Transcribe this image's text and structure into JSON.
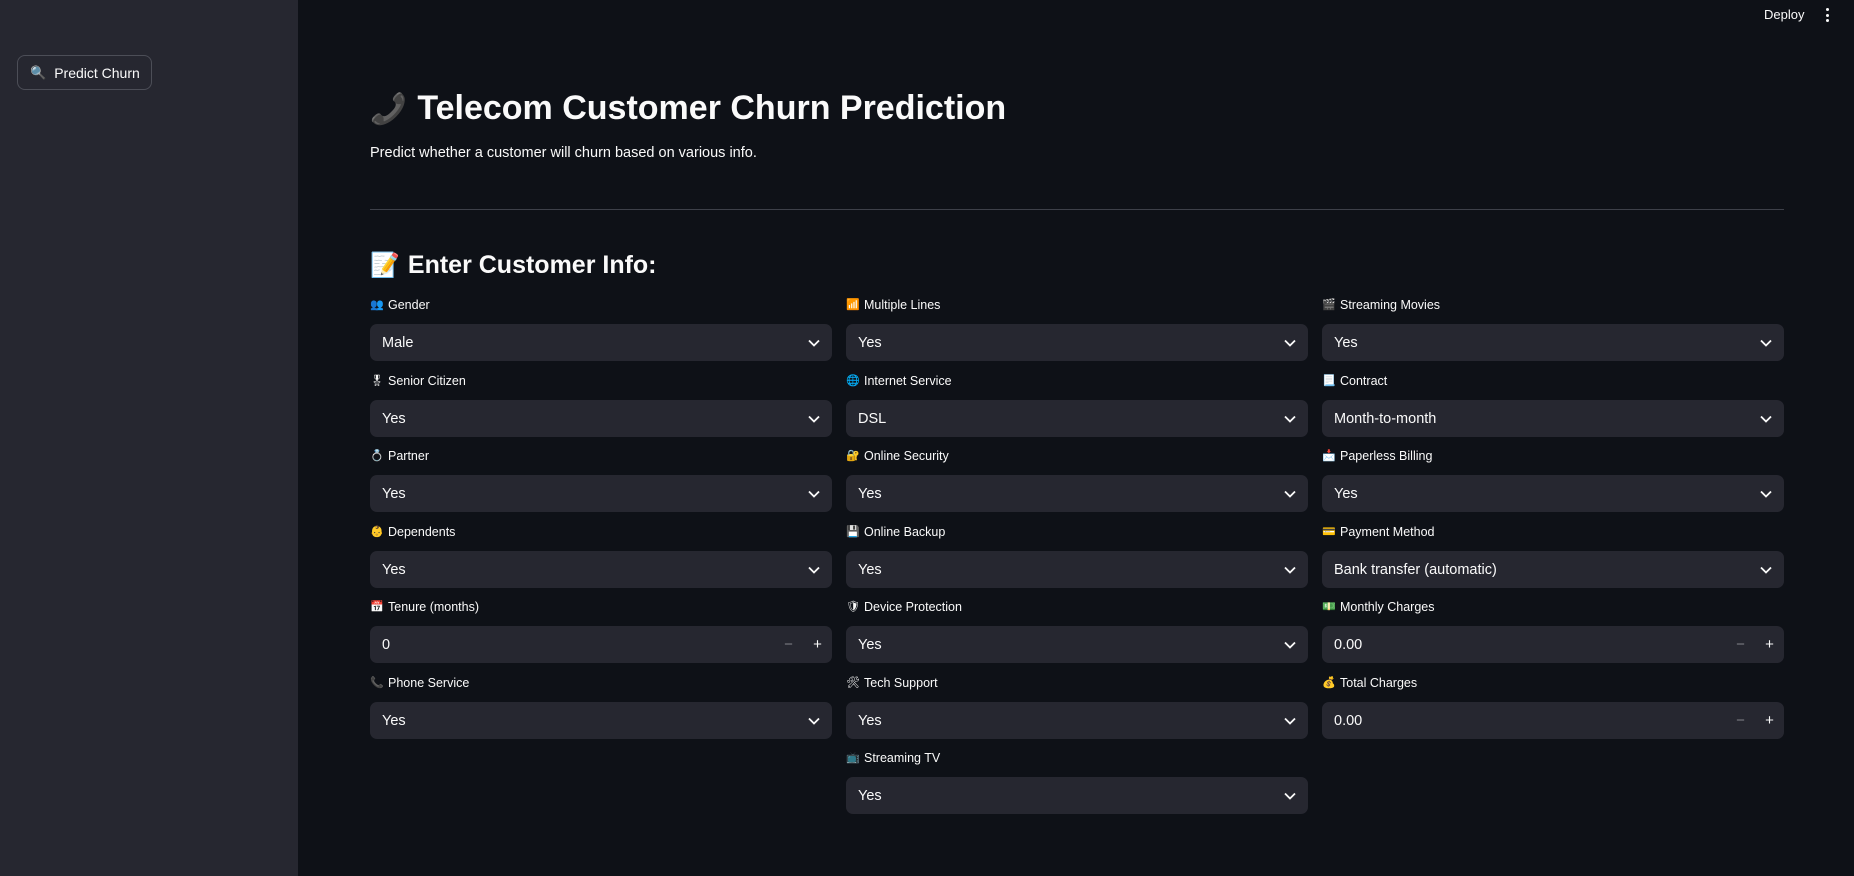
{
  "sidebar": {
    "predict_button": {
      "icon": "magnifier-emoji",
      "icon_glyph": "🔍",
      "label": "Predict Churn"
    }
  },
  "topbar": {
    "deploy_label": "Deploy",
    "menu_icon": "kebab-menu-icon"
  },
  "header": {
    "title_emoji": "📞",
    "title": "Telecom Customer Churn Prediction",
    "subtitle": "Predict whether a customer will churn based on various info."
  },
  "form": {
    "section_emoji": "📝",
    "section_title": "Enter Customer Info:",
    "fields": [
      {
        "id": "gender",
        "emoji": "👥",
        "label": "Gender",
        "type": "select",
        "value": "Male"
      },
      {
        "id": "senior",
        "emoji": "🎖",
        "label": "Senior Citizen",
        "type": "select",
        "value": "Yes"
      },
      {
        "id": "partner",
        "emoji": "💍",
        "label": "Partner",
        "type": "select",
        "value": "Yes"
      },
      {
        "id": "dependents",
        "emoji": "👶",
        "label": "Dependents",
        "type": "select",
        "value": "Yes"
      },
      {
        "id": "tenure",
        "emoji": "📅",
        "label": "Tenure (months)",
        "type": "number",
        "value": "0",
        "minus": "−",
        "plus": "+"
      },
      {
        "id": "phone",
        "emoji": "📞",
        "label": "Phone Service",
        "type": "select",
        "value": "Yes"
      },
      {
        "id": "multiple_lines",
        "emoji": "📶",
        "label": "Multiple Lines",
        "type": "select",
        "value": "Yes"
      },
      {
        "id": "internet",
        "emoji": "🌐",
        "label": "Internet Service",
        "type": "select",
        "value": "DSL"
      },
      {
        "id": "online_security",
        "emoji": "🔐",
        "label": "Online Security",
        "type": "select",
        "value": "Yes"
      },
      {
        "id": "online_backup",
        "emoji": "💾",
        "label": "Online Backup",
        "type": "select",
        "value": "Yes"
      },
      {
        "id": "device_protection",
        "emoji": "🛡",
        "label": "Device Protection",
        "type": "select",
        "value": "Yes"
      },
      {
        "id": "tech_support",
        "emoji": "🛠",
        "label": "Tech Support",
        "type": "select",
        "value": "Yes"
      },
      {
        "id": "streaming_tv",
        "emoji": "📺",
        "label": "Streaming TV",
        "type": "select",
        "value": "Yes"
      },
      {
        "id": "streaming_movies",
        "emoji": "🎬",
        "label": "Streaming Movies",
        "type": "select",
        "value": "Yes"
      },
      {
        "id": "contract",
        "emoji": "📃",
        "label": "Contract",
        "type": "select",
        "value": "Month-to-month"
      },
      {
        "id": "paperless",
        "emoji": "📩",
        "label": "Paperless Billing",
        "type": "select",
        "value": "Yes"
      },
      {
        "id": "payment",
        "emoji": "💳",
        "label": "Payment Method",
        "type": "select",
        "value": "Bank transfer (automatic)"
      },
      {
        "id": "monthly",
        "emoji": "💵",
        "label": "Monthly Charges",
        "type": "number",
        "value": "0.00",
        "minus": "−",
        "plus": "+"
      },
      {
        "id": "total",
        "emoji": "💰",
        "label": "Total Charges",
        "type": "number",
        "value": "0.00",
        "minus": "−",
        "plus": "+"
      }
    ]
  }
}
